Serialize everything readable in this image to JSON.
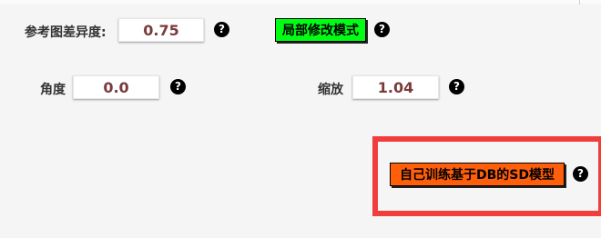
{
  "row1": {
    "ref_diff_label": "参考图差异度:",
    "ref_diff_value": "0.75",
    "local_edit_button": "局部修改模式"
  },
  "row2": {
    "angle_label": "角度",
    "angle_value": "0.0",
    "scale_label": "缩放",
    "scale_value": "1.04"
  },
  "row3": {
    "custom_db_button": "自己训练基于DB的SD模型"
  },
  "help_glyph": "?",
  "icons": [
    "help-icon"
  ],
  "colors": {
    "background": "#f5f5f5",
    "value_text": "#7a3b3b",
    "green_button": "#00ff14",
    "orange_button": "#ff5e0a",
    "highlight_border": "#f23d3d"
  }
}
